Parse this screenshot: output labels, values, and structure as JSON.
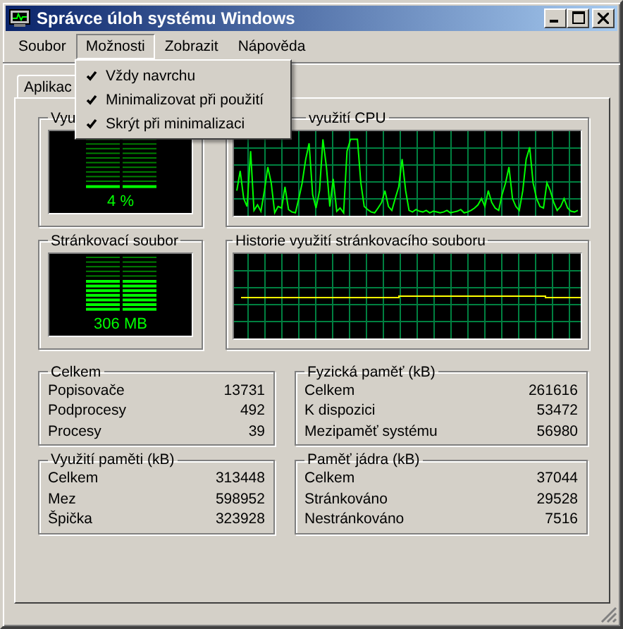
{
  "window": {
    "title": "Správce úloh systému Windows"
  },
  "menu": [
    {
      "label": "Soubor",
      "selected": false
    },
    {
      "label": "Možnosti",
      "selected": true
    },
    {
      "label": "Zobrazit",
      "selected": false
    },
    {
      "label": "Nápověda",
      "selected": false
    }
  ],
  "dropdown": [
    {
      "label": "Vždy navrchu",
      "checked": true
    },
    {
      "label": "Minimalizovat při použití",
      "checked": true
    },
    {
      "label": "Skrýt při minimalizaci",
      "checked": true
    }
  ],
  "tabs": [
    {
      "label": "Aplikac",
      "selected": false
    }
  ],
  "meters": [
    {
      "title": "Vyu",
      "reading": "4 %",
      "level": 0.04
    },
    {
      "title": "Stránkovací soubor",
      "reading": "306 MB",
      "level": 0.55
    }
  ],
  "graphs": [
    {
      "title": "využití CPU",
      "kind": "cpu"
    },
    {
      "title": "Historie využití stránkovacího souboru",
      "kind": "pagefile"
    }
  ],
  "stats": [
    {
      "title": "Celkem",
      "rows": [
        {
          "label": "Popisovače",
          "value": "13731"
        },
        {
          "label": "Podprocesy",
          "value": "492"
        },
        {
          "label": "Procesy",
          "value": "39"
        }
      ]
    },
    {
      "title": "Fyzická paměť (kB)",
      "rows": [
        {
          "label": "Celkem",
          "value": "261616"
        },
        {
          "label": "K dispozici",
          "value": "53472"
        },
        {
          "label": "Mezipaměť systému",
          "value": "56980"
        }
      ]
    },
    {
      "title": "Využití paměti (kB)",
      "rows": [
        {
          "label": "Celkem",
          "value": "313448"
        },
        {
          "label": "Mez",
          "value": "598952"
        },
        {
          "label": "Špička",
          "value": "323928"
        }
      ]
    },
    {
      "title": "Paměť jádra (kB)",
      "rows": [
        {
          "label": "Celkem",
          "value": "37044"
        },
        {
          "label": "Stránkováno",
          "value": "29528"
        },
        {
          "label": "Nestránkováno",
          "value": "7516"
        }
      ]
    }
  ]
}
